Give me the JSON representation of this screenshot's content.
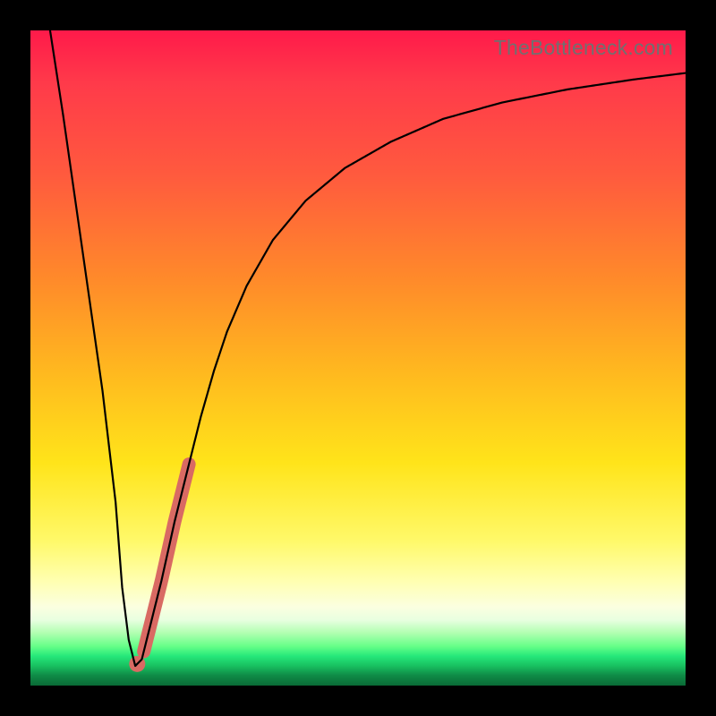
{
  "watermark": "TheBottleneck.com",
  "colors": {
    "highlight": "#d96a63",
    "curve": "#000000"
  },
  "chart_data": {
    "type": "line",
    "title": "",
    "xlabel": "",
    "ylabel": "",
    "xlim": [
      0,
      100
    ],
    "ylim": [
      0,
      100
    ],
    "grid": false,
    "legend": false,
    "series": [
      {
        "name": "bottleneck-curve",
        "x": [
          3,
          5,
          7,
          9,
          11,
          13,
          14,
          15,
          16,
          17,
          18,
          20,
          22,
          24,
          26,
          28,
          30,
          33,
          37,
          42,
          48,
          55,
          63,
          72,
          82,
          92,
          100
        ],
        "y": [
          100,
          87,
          73,
          59,
          45,
          28,
          15,
          7,
          3,
          4,
          8,
          16,
          25,
          33,
          41,
          48,
          54,
          61,
          68,
          74,
          79,
          83,
          86.5,
          89,
          91,
          92.5,
          93.5
        ]
      }
    ],
    "highlight": {
      "segment_x_range": [
        17.3,
        24.2
      ],
      "marker_x": 16.3
    }
  }
}
